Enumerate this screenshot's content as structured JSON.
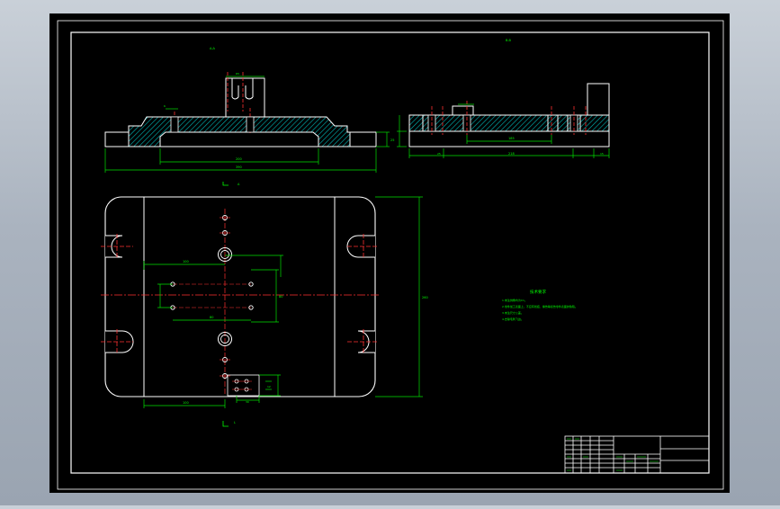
{
  "drawing": {
    "view_labels": {
      "front_view": "A-A",
      "side_view": "B-B",
      "plan_view": "A",
      "plan_view_bottom": "L"
    },
    "dimensions": {
      "base_length": "360",
      "overall_length": "390",
      "bottom_length": "200",
      "side_inner": "185",
      "side_total": "218",
      "side_small": "25",
      "side_right": "15",
      "plan_height": "260",
      "plan_width_a": "100",
      "plan_width_b": "80",
      "plan_vert": "80",
      "plan_bottom": "100",
      "plan_small_1": "12",
      "plan_small_2": "30",
      "front_height": "25",
      "front_tiny_1": "6",
      "front_tiny_2": "R5"
    },
    "technical_requirements": {
      "title": "技术要求",
      "lines": [
        "1.未注倒角均为C1。",
        "2.零件加工表面上，不应有划痕、擦伤等损伤零件表面的缺陷。",
        "3.未注尺寸公差。",
        "4.去除毛刺飞边。"
      ]
    },
    "title_block": {
      "cells": [
        "",
        "",
        "",
        "",
        "",
        "",
        ""
      ]
    }
  },
  "colors": {
    "canvas": "#000000",
    "frame": "#ffffff",
    "dimension": "#00ff00",
    "centerline": "#ff0000",
    "hatch": "#00ffff",
    "object": "#ffffff",
    "text": "#00ff00"
  }
}
